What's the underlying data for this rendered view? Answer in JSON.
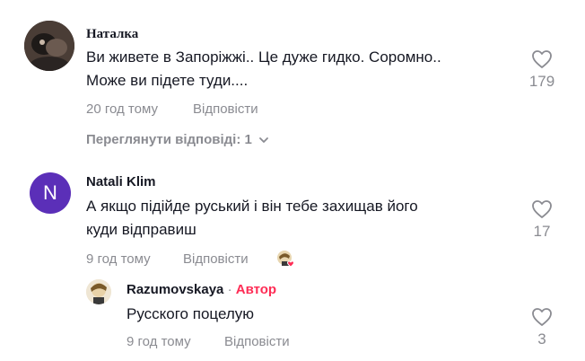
{
  "comments": [
    {
      "author": "Наталка",
      "line1": "Ви живете в Запоріжжі.. Це дуже гидко. Соромно..",
      "line2": "Може ви підете туди....",
      "time": "20 год тому",
      "reply": "Відповісти",
      "likes": "179",
      "view_replies": "Переглянути відповіді: 1"
    },
    {
      "author": "Natali Klim",
      "avatar_letter": "N",
      "line1": "А якщо підійде руський і він тебе захищав його",
      "line2": "куди відправиш",
      "time": "9 год тому",
      "reply": "Відповісти",
      "likes": "17"
    }
  ],
  "reply": {
    "author": "Razumovskaya",
    "separator": "·",
    "badge": "Автор",
    "text": "Русского поцелую",
    "time": "9 год тому",
    "reply": "Відповісти",
    "likes": "3"
  },
  "colors": {
    "avatar_purple": "#5b2fb8",
    "author_badge": "#fe2c55",
    "muted": "#8a8b91"
  }
}
